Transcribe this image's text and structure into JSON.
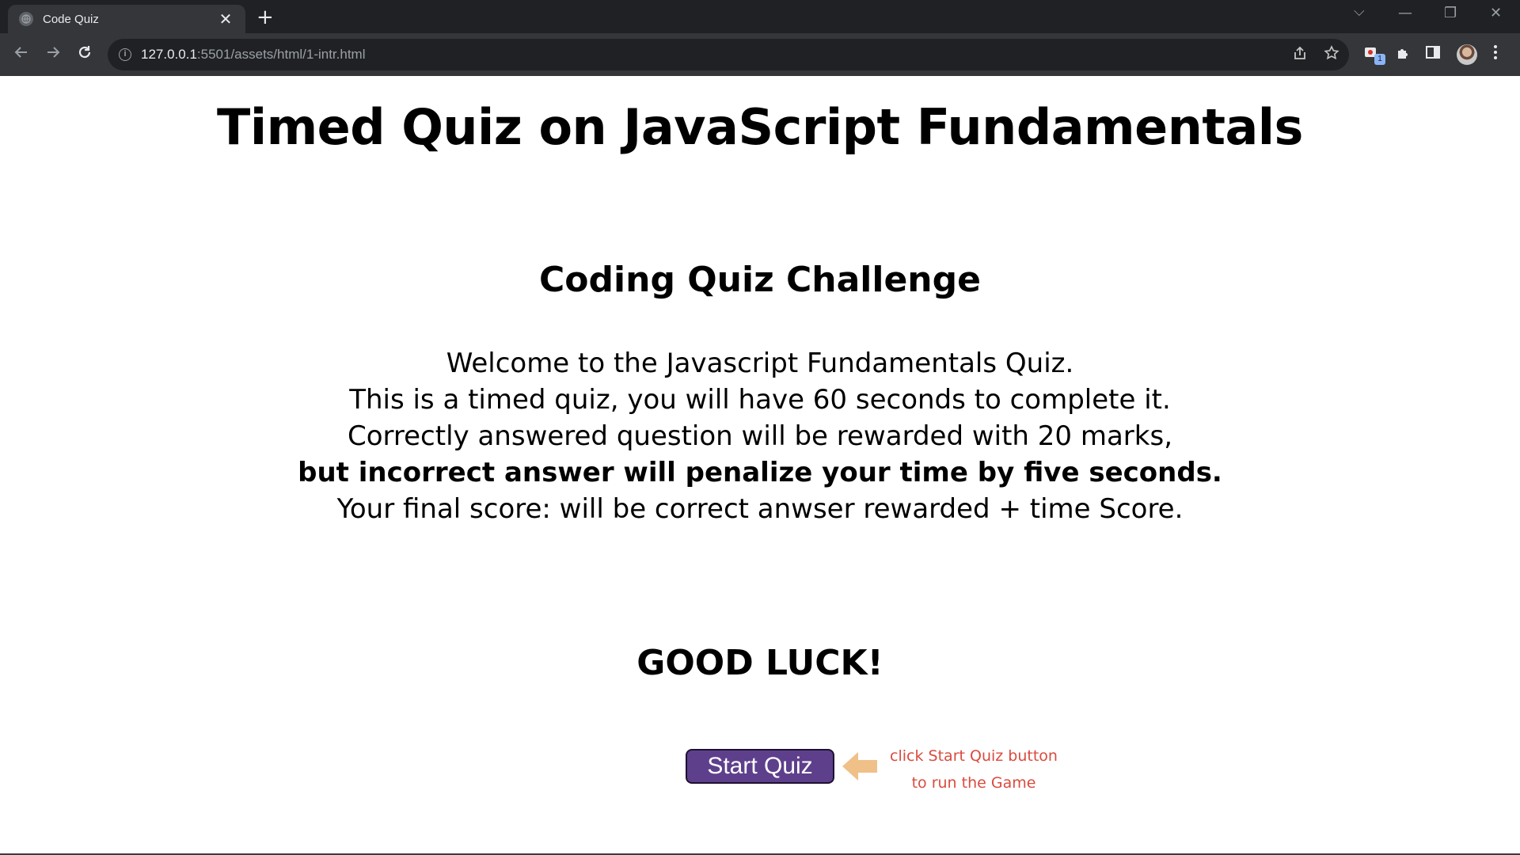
{
  "browser": {
    "tab_title": "Code Quiz",
    "tab_close": "✕",
    "new_tab": "+",
    "url_host": "127.0.0.1",
    "url_rest": ":5501/assets/html/1-intr.html",
    "window_controls": [
      "⌵",
      "—",
      "❐",
      "✕"
    ],
    "extension_badge": "1",
    "icons": [
      "back-arrow-icon",
      "forward-arrow-icon",
      "reload-icon",
      "info-icon",
      "share-icon",
      "star-icon",
      "extension-icon",
      "puzzle-icon",
      "side-panel-icon",
      "profile-avatar",
      "menu-icon"
    ]
  },
  "page": {
    "main_title": "Timed Quiz on JavaScript Fundamentals",
    "challenge_title": "Coding Quiz Challenge",
    "intro_line1": "Welcome to the Javascript Fundamentals Quiz.",
    "intro_line2": "This is a timed quiz, you will have 60 seconds to complete it.",
    "intro_line3": "Correctly answered question will be rewarded with 20 marks,",
    "intro_line4": "but incorrect answer will penalize your time by five seconds.",
    "intro_line5": "Your final score: will be correct anwser rewarded + time Score.",
    "good_luck": "GOOD LUCK!",
    "start_button": "Start Quiz",
    "hint_line1": "click Start Quiz button",
    "hint_line2": "to run the Game"
  },
  "colors": {
    "button_bg": "#5e3f8c",
    "hint_text": "#d94b3f",
    "arrow": "#f0c089"
  }
}
